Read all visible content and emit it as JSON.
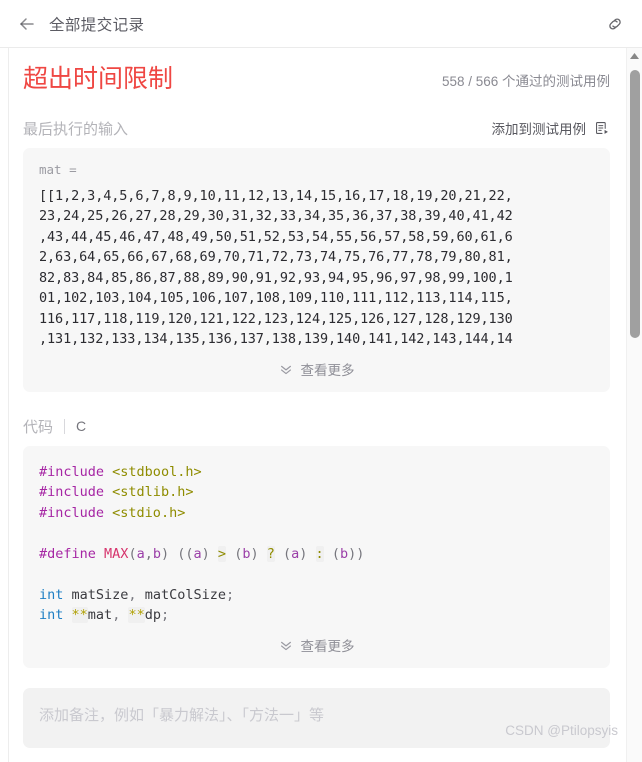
{
  "topbar": {
    "back_icon": "arrow-left-icon",
    "title": "全部提交记录",
    "link_icon": "chain-link-icon"
  },
  "result": {
    "verdict": "超出时间限制",
    "verdict_color": "#ef4743",
    "passed": "558",
    "separator": "/",
    "total": "566",
    "count_suffix": "个通过的测试用例",
    "count_text": "558 / 566  个通过的测试用例"
  },
  "input_section": {
    "title": "最后执行的输入",
    "action_label": "添加到测试用例",
    "action_icon": "add-testcase-icon",
    "var_label": "mat =",
    "lines": [
      "[[1,2,3,4,5,6,7,8,9,10,11,12,13,14,15,16,17,18,19,20,21,22,",
      "23,24,25,26,27,28,29,30,31,32,33,34,35,36,37,38,39,40,41,42",
      ",43,44,45,46,47,48,49,50,51,52,53,54,55,56,57,58,59,60,61,6",
      "2,63,64,65,66,67,68,69,70,71,72,73,74,75,76,77,78,79,80,81,",
      "82,83,84,85,86,87,88,89,90,91,92,93,94,95,96,97,98,99,100,1",
      "01,102,103,104,105,106,107,108,109,110,111,112,113,114,115,",
      "116,117,118,119,120,121,122,123,124,125,126,127,128,129,130",
      ",131,132,133,134,135,136,137,138,139,140,141,142,143,144,14"
    ],
    "view_more": "查看更多",
    "view_more_icon": "double-chevron-down-icon"
  },
  "code_section": {
    "title": "代码",
    "language": "C",
    "view_more": "查看更多",
    "view_more_icon": "double-chevron-down-icon",
    "lines": [
      {
        "id": "l1",
        "tokens": [
          {
            "t": "#include",
            "c": "t-pre"
          },
          {
            "t": " ",
            "c": "t-id"
          },
          {
            "t": "<stdbool.h>",
            "c": "t-str"
          }
        ]
      },
      {
        "id": "l2",
        "tokens": [
          {
            "t": "#include",
            "c": "t-pre"
          },
          {
            "t": " ",
            "c": "t-id"
          },
          {
            "t": "<stdlib.h>",
            "c": "t-str"
          }
        ]
      },
      {
        "id": "l3",
        "tokens": [
          {
            "t": "#include",
            "c": "t-pre"
          },
          {
            "t": " ",
            "c": "t-id"
          },
          {
            "t": "<stdio.h>",
            "c": "t-str"
          }
        ]
      },
      {
        "id": "l4",
        "tokens": []
      },
      {
        "id": "l5",
        "tokens": [
          {
            "t": "#define",
            "c": "t-pre"
          },
          {
            "t": " ",
            "c": "t-id"
          },
          {
            "t": "MAX",
            "c": "t-fn"
          },
          {
            "t": "(",
            "c": "t-punc"
          },
          {
            "t": "a",
            "c": "t-var"
          },
          {
            "t": ",",
            "c": "t-punc"
          },
          {
            "t": "b",
            "c": "t-var"
          },
          {
            "t": ") ((",
            "c": "t-punc"
          },
          {
            "t": "a",
            "c": "t-var"
          },
          {
            "t": ") ",
            "c": "t-punc"
          },
          {
            "t": ">",
            "c": "t-op"
          },
          {
            "t": " (",
            "c": "t-punc"
          },
          {
            "t": "b",
            "c": "t-var"
          },
          {
            "t": ") ",
            "c": "t-punc"
          },
          {
            "t": "?",
            "c": "t-op"
          },
          {
            "t": " (",
            "c": "t-punc"
          },
          {
            "t": "a",
            "c": "t-var"
          },
          {
            "t": ") ",
            "c": "t-punc"
          },
          {
            "t": ":",
            "c": "t-op"
          },
          {
            "t": " (",
            "c": "t-punc"
          },
          {
            "t": "b",
            "c": "t-var"
          },
          {
            "t": "))",
            "c": "t-punc"
          }
        ]
      },
      {
        "id": "l6",
        "tokens": []
      },
      {
        "id": "l7",
        "tokens": [
          {
            "t": "int",
            "c": "t-kw"
          },
          {
            "t": " matSize",
            "c": "t-id"
          },
          {
            "t": ",",
            "c": "t-punc"
          },
          {
            "t": " matColSize",
            "c": "t-id"
          },
          {
            "t": ";",
            "c": "t-punc"
          }
        ]
      },
      {
        "id": "l8",
        "tokens": [
          {
            "t": "int",
            "c": "t-kw"
          },
          {
            "t": " ",
            "c": "t-id"
          },
          {
            "t": "**",
            "c": "t-op2"
          },
          {
            "t": "mat",
            "c": "t-id"
          },
          {
            "t": ",",
            "c": "t-punc"
          },
          {
            "t": " ",
            "c": "t-id"
          },
          {
            "t": "**",
            "c": "t-op2"
          },
          {
            "t": "dp",
            "c": "t-id"
          },
          {
            "t": ";",
            "c": "t-punc"
          }
        ]
      }
    ]
  },
  "note": {
    "placeholder": "添加备注，例如「暴力解法」、「方法一」等"
  },
  "watermark": "CSDN @Ptilopsyis",
  "scrollbar": {
    "up_arrow_icon": "triangle-up-icon",
    "thumb": "scrollbar-thumb"
  }
}
